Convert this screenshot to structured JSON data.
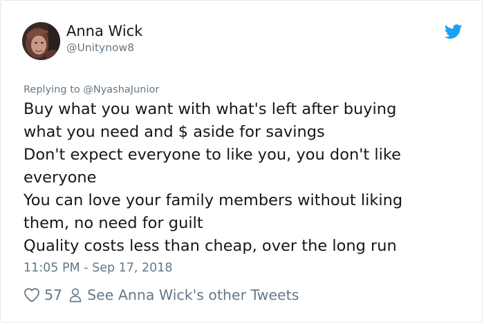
{
  "tweet": {
    "author": {
      "name": "Anna Wick",
      "handle": "@Unitynow8"
    },
    "replying_to": "Replying to @NyashaJunior",
    "body_lines": [
      "Buy what you want with what's left after buying",
      "what you need and $ aside for savings",
      "Don't expect everyone to like you, you don't like",
      "everyone",
      "You can love your family members without liking",
      "them, no need for guilt",
      "Quality costs less than cheap, over the long run"
    ],
    "timestamp": "11:05 PM - Sep 17, 2018",
    "likes": "57",
    "other_tweets_link": "See Anna Wick's other Tweets"
  },
  "icons": {
    "brand": "twitter-bird-icon",
    "like": "heart-icon",
    "profile": "person-icon"
  },
  "colors": {
    "brand_blue": "#1da1f2",
    "text_primary": "#14171a",
    "text_secondary": "#657786",
    "border": "#e1e8ed"
  }
}
